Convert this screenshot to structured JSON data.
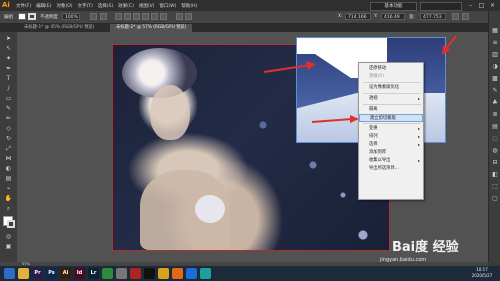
{
  "app": {
    "logo": "Ai",
    "menu": [
      "文件(F)",
      "编辑(E)",
      "对象(O)",
      "文字(T)",
      "选择(S)",
      "效果(C)",
      "视图(V)",
      "窗口(W)",
      "帮助(H)"
    ],
    "workspace": "基本功能",
    "window_buttons": [
      "–",
      "□",
      "×"
    ]
  },
  "control_bar": {
    "selection_label": "编组",
    "opacity_label": "不透明度",
    "opacity_value": "100%",
    "x_label": "X:",
    "x_value": "714.166",
    "y_label": "Y:",
    "y_value": "416.49",
    "w_label": "宽:",
    "w_value": "477.753"
  },
  "tabs": [
    {
      "label": "未标题-1* @ 45% (RGB/GPU 预览)"
    },
    {
      "label": "未标题-2* @ 57% (RGB/GPU 预览)"
    }
  ],
  "context_menu": {
    "items": [
      {
        "label": "还原移动",
        "dim": false
      },
      {
        "label": "重做(R)",
        "dim": true
      },
      {
        "label": "sep"
      },
      {
        "label": "设为像素级优化",
        "dim": false
      },
      {
        "label": "sep"
      },
      {
        "label": "透视",
        "dim": false,
        "submenu": true
      },
      {
        "label": "sep"
      },
      {
        "label": "隔离",
        "dim": false
      },
      {
        "label": "建立剪切蒙版",
        "dim": false,
        "highlight": true
      },
      {
        "label": "sep"
      },
      {
        "label": "变换",
        "dim": false,
        "submenu": true
      },
      {
        "label": "排列",
        "dim": false,
        "submenu": true
      },
      {
        "label": "选择",
        "dim": false,
        "submenu": true
      },
      {
        "label": "添加到库",
        "dim": false
      },
      {
        "label": "收集以导出",
        "dim": false,
        "submenu": true
      },
      {
        "label": "导出所选项目...",
        "dim": false
      }
    ]
  },
  "status_bar": {
    "zoom": "57%"
  },
  "taskbar": {
    "apps": [
      {
        "name": "windows-logo-icon",
        "label": "",
        "color": "#2d6cc4"
      },
      {
        "name": "explorer-icon",
        "label": "",
        "color": "#e3b23c"
      },
      {
        "name": "premiere-icon",
        "label": "Pr",
        "color": "#2b1a4e"
      },
      {
        "name": "photoshop-icon",
        "label": "Ps",
        "color": "#0a2a4a"
      },
      {
        "name": "illustrator-icon",
        "label": "Ai",
        "color": "#3a1d05"
      },
      {
        "name": "indesign-icon",
        "label": "Id",
        "color": "#4a0a24"
      },
      {
        "name": "lightroom-icon",
        "label": "Lr",
        "color": "#0a2333"
      },
      {
        "name": "app-green-icon",
        "label": "",
        "color": "#2d8a3e"
      },
      {
        "name": "media-icon",
        "label": "",
        "color": "#777"
      },
      {
        "name": "app-red-icon",
        "label": "",
        "color": "#b22222"
      },
      {
        "name": "qq-icon",
        "label": "",
        "color": "#111"
      },
      {
        "name": "chrome-icon",
        "label": "",
        "color": "#d9a21b"
      },
      {
        "name": "app-orange-icon",
        "label": "",
        "color": "#e06a1b"
      },
      {
        "name": "app-blue-icon",
        "label": "",
        "color": "#1b6ed9"
      },
      {
        "name": "app-teal-icon",
        "label": "",
        "color": "#1ba0a0"
      }
    ],
    "time": "10:17",
    "date": "2020/5/27"
  },
  "watermark": {
    "brand": "Bai度 经验",
    "url": "jingyan.baidu.com"
  },
  "colors": {
    "accent_red": "#e0302a",
    "selection_blue": "#5b8fd6"
  }
}
